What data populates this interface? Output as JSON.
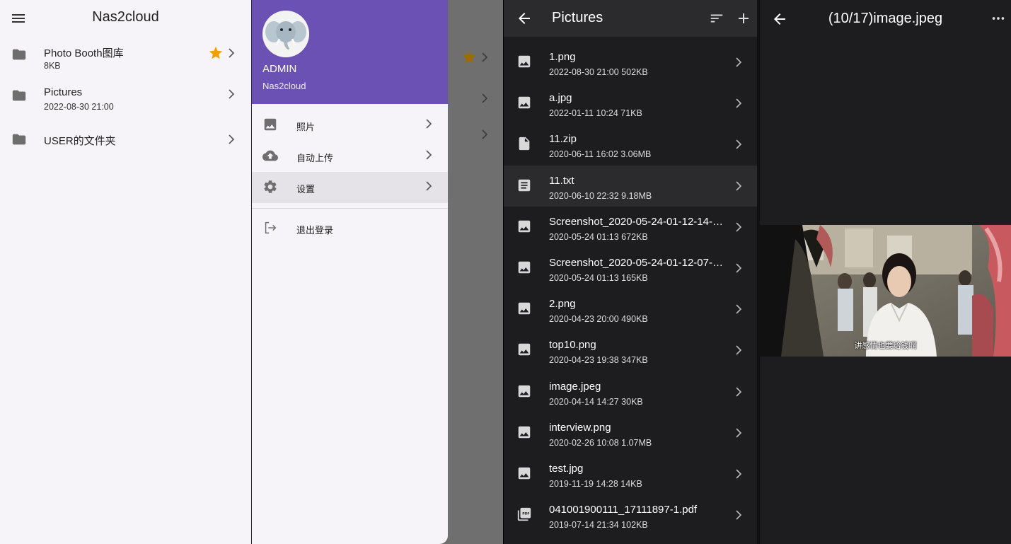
{
  "home": {
    "title": "Nas2cloud",
    "folders": [
      {
        "name": "Photo Booth图库",
        "meta": "8KB",
        "starred": true
      },
      {
        "name": "Pictures",
        "meta": "2022-08-30 21:00",
        "starred": false
      },
      {
        "name": "USER的文件夹",
        "meta": "",
        "starred": false
      }
    ]
  },
  "drawer": {
    "username": "ADMIN",
    "app_name": "Nas2cloud",
    "items": [
      {
        "label": "照片",
        "icon": "image-icon"
      },
      {
        "label": "自动上传",
        "icon": "cloud-upload-icon"
      },
      {
        "label": "设置",
        "icon": "gear-icon"
      }
    ],
    "logout_label": "退出登录"
  },
  "browser": {
    "title": "Pictures",
    "files": [
      {
        "name": "1.png",
        "meta": "2022-08-30 21:00 502KB",
        "icon": "image-icon"
      },
      {
        "name": "a.jpg",
        "meta": "2022-01-11 10:24 71KB",
        "icon": "image-icon"
      },
      {
        "name": "11.zip",
        "meta": "2020-06-11 16:02 3.06MB",
        "icon": "file-icon"
      },
      {
        "name": "11.txt",
        "meta": "2020-06-10 22:32 9.18MB",
        "icon": "document-icon"
      },
      {
        "name": "Screenshot_2020-05-24-01-12-14-5...",
        "meta": "2020-05-24 01:13 672KB",
        "icon": "image-icon"
      },
      {
        "name": "Screenshot_2020-05-24-01-12-07-6...",
        "meta": "2020-05-24 01:13 165KB",
        "icon": "image-icon"
      },
      {
        "name": "2.png",
        "meta": "2020-04-23 20:00 490KB",
        "icon": "image-icon"
      },
      {
        "name": "top10.png",
        "meta": "2020-04-23 19:38 347KB",
        "icon": "image-icon"
      },
      {
        "name": "image.jpeg",
        "meta": "2020-04-14 14:27 30KB",
        "icon": "image-icon"
      },
      {
        "name": "interview.png",
        "meta": "2020-02-26 10:08 1.07MB",
        "icon": "image-icon"
      },
      {
        "name": "test.jpg",
        "meta": "2019-11-19 14:28 14KB",
        "icon": "image-icon"
      },
      {
        "name": "041001900111_17111897-1.pdf",
        "meta": "2019-07-14 21:34 102KB",
        "icon": "pdf-icon"
      }
    ]
  },
  "viewer": {
    "title": "(10/17)image.jpeg",
    "subtitle": "讲感情也要给钱啊"
  },
  "colors": {
    "accent": "#6a51b3",
    "star": "#f0a000",
    "dark_bg": "#1d1d1f",
    "light_bg": "#f6f4f8"
  }
}
